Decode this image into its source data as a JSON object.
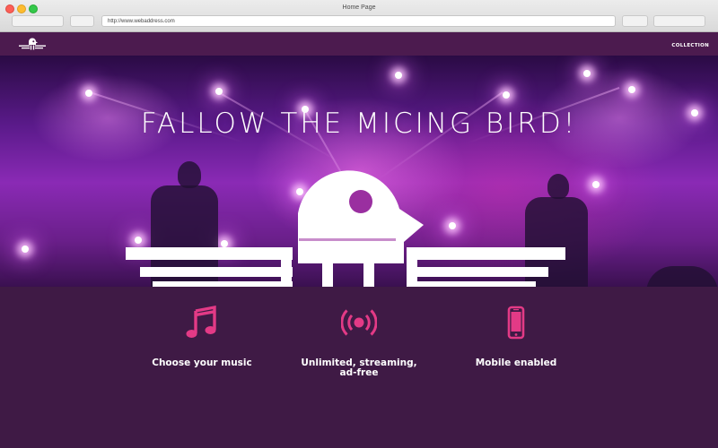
{
  "browser": {
    "window_title": "Home Page",
    "url": "http://www.webaddress.com"
  },
  "nav": {
    "logo_icon": "bird-logo-icon",
    "link_label": "COLLECTION"
  },
  "hero": {
    "title": "FALLOW THE MICING BIRD!",
    "emblem_icon": "bird-emblem-icon"
  },
  "features": [
    {
      "icon": "music-note-icon",
      "label": "Choose your music"
    },
    {
      "icon": "broadcast-icon",
      "label": "Unlimited, streaming, ad-free"
    },
    {
      "icon": "smartphone-icon",
      "label": "Mobile enabled"
    }
  ],
  "colors": {
    "nav_bg": "#4c1b4f",
    "page_bg": "#3f1a45",
    "accent": "#e33a86"
  }
}
